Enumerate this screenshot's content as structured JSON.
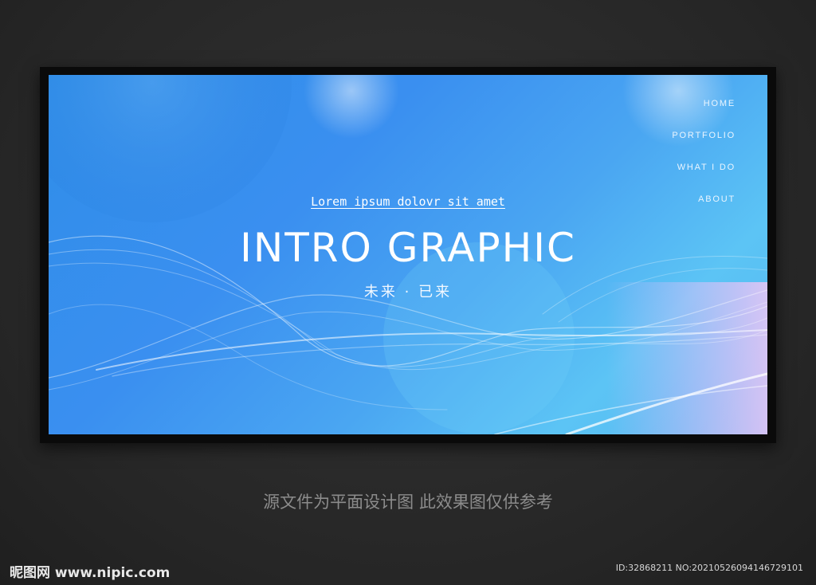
{
  "nav": {
    "items": [
      {
        "label": "HOME"
      },
      {
        "label": "PORTFOLIO"
      },
      {
        "label": "WHAT I DO"
      },
      {
        "label": "ABOUT"
      }
    ]
  },
  "hero": {
    "tagline": "Lorem ipsum dolovr sit amet",
    "title": "INTRO GRAPHIC",
    "subtitle": "未来 · 已来"
  },
  "caption": "源文件为平面设计图 此效果图仅供参考",
  "watermark": {
    "logo": "昵图网 www.nipic.com",
    "image_id": "ID:32868211 NO:20210526094146729101"
  },
  "colors": {
    "page_background": "#2b2b2b",
    "banner_start": "#2f8ee8",
    "banner_end": "#5cc4f5",
    "text": "#ffffff"
  }
}
